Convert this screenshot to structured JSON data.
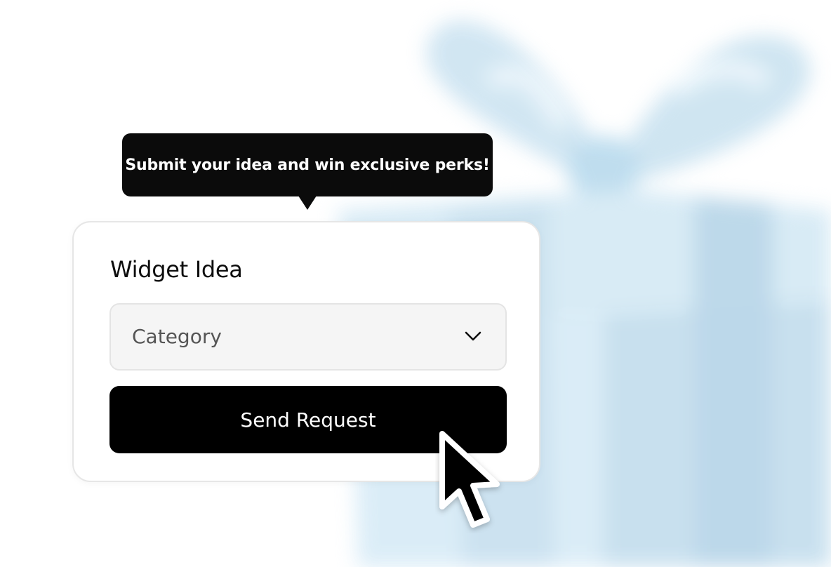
{
  "tooltip": {
    "text": "Submit your idea and win exclusive perks!"
  },
  "card": {
    "title": "Widget Idea",
    "category_select": {
      "placeholder": "Category",
      "icon": "chevron-down-icon"
    },
    "submit_button": {
      "label": "Send Request"
    }
  },
  "decor": {
    "background_icon": "gift-box-icon",
    "cursor_icon": "mouse-pointer-icon"
  },
  "colors": {
    "primary": "#000000",
    "tooltip_bg": "#0b0b0b",
    "select_bg": "#f5f5f5",
    "gift_blue": "#cfe6f3"
  }
}
